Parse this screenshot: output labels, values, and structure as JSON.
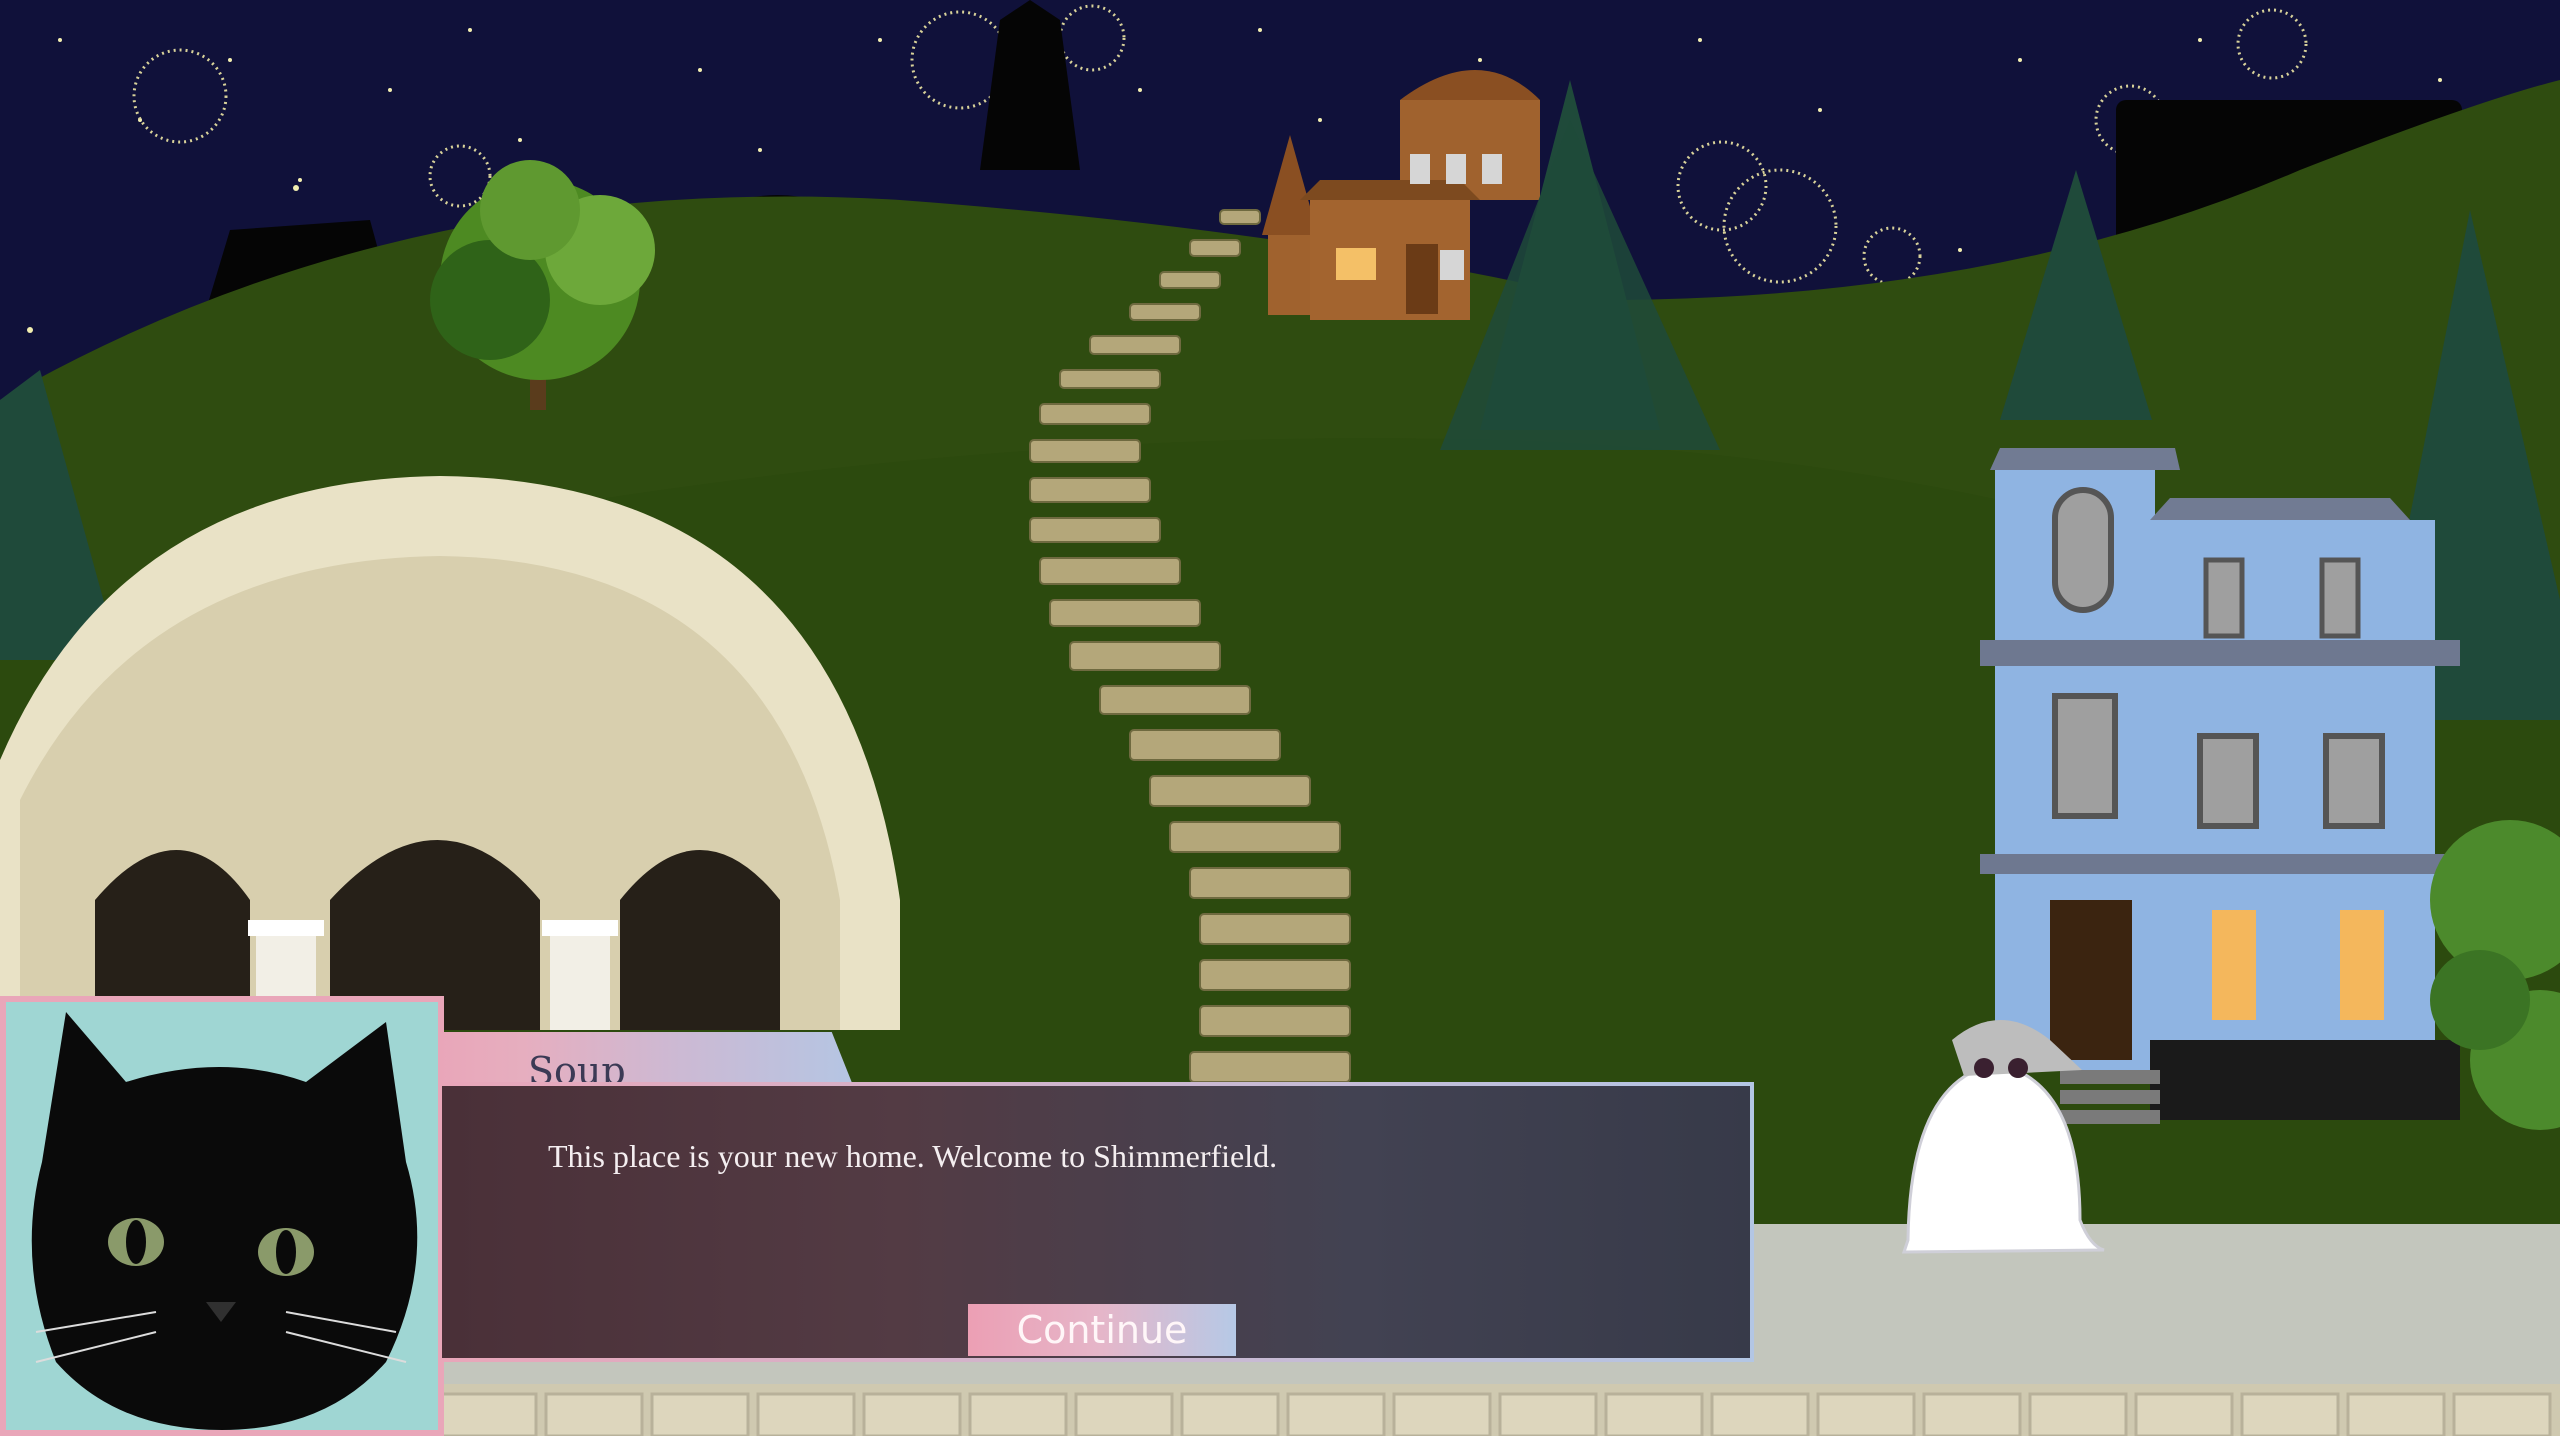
{
  "speaker": {
    "name": "Soup"
  },
  "dialog": {
    "line": "This place is your new home. Welcome to Shimmerfield."
  },
  "controls": {
    "continue_label": "Continue"
  },
  "colors": {
    "sky": "#10113a",
    "hill": "#2f4c10",
    "accent_pink": "#e9a6b9",
    "accent_blue": "#b3c6e4",
    "dialog_bg": "#4a3a42",
    "portrait_bg": "#9fd6d3"
  },
  "scene": {
    "characters": [
      "black-cat",
      "ghost-in-hat"
    ],
    "buildings": [
      "stone-arch-ruin",
      "victorian-blue-house",
      "hilltop-brown-house"
    ]
  }
}
